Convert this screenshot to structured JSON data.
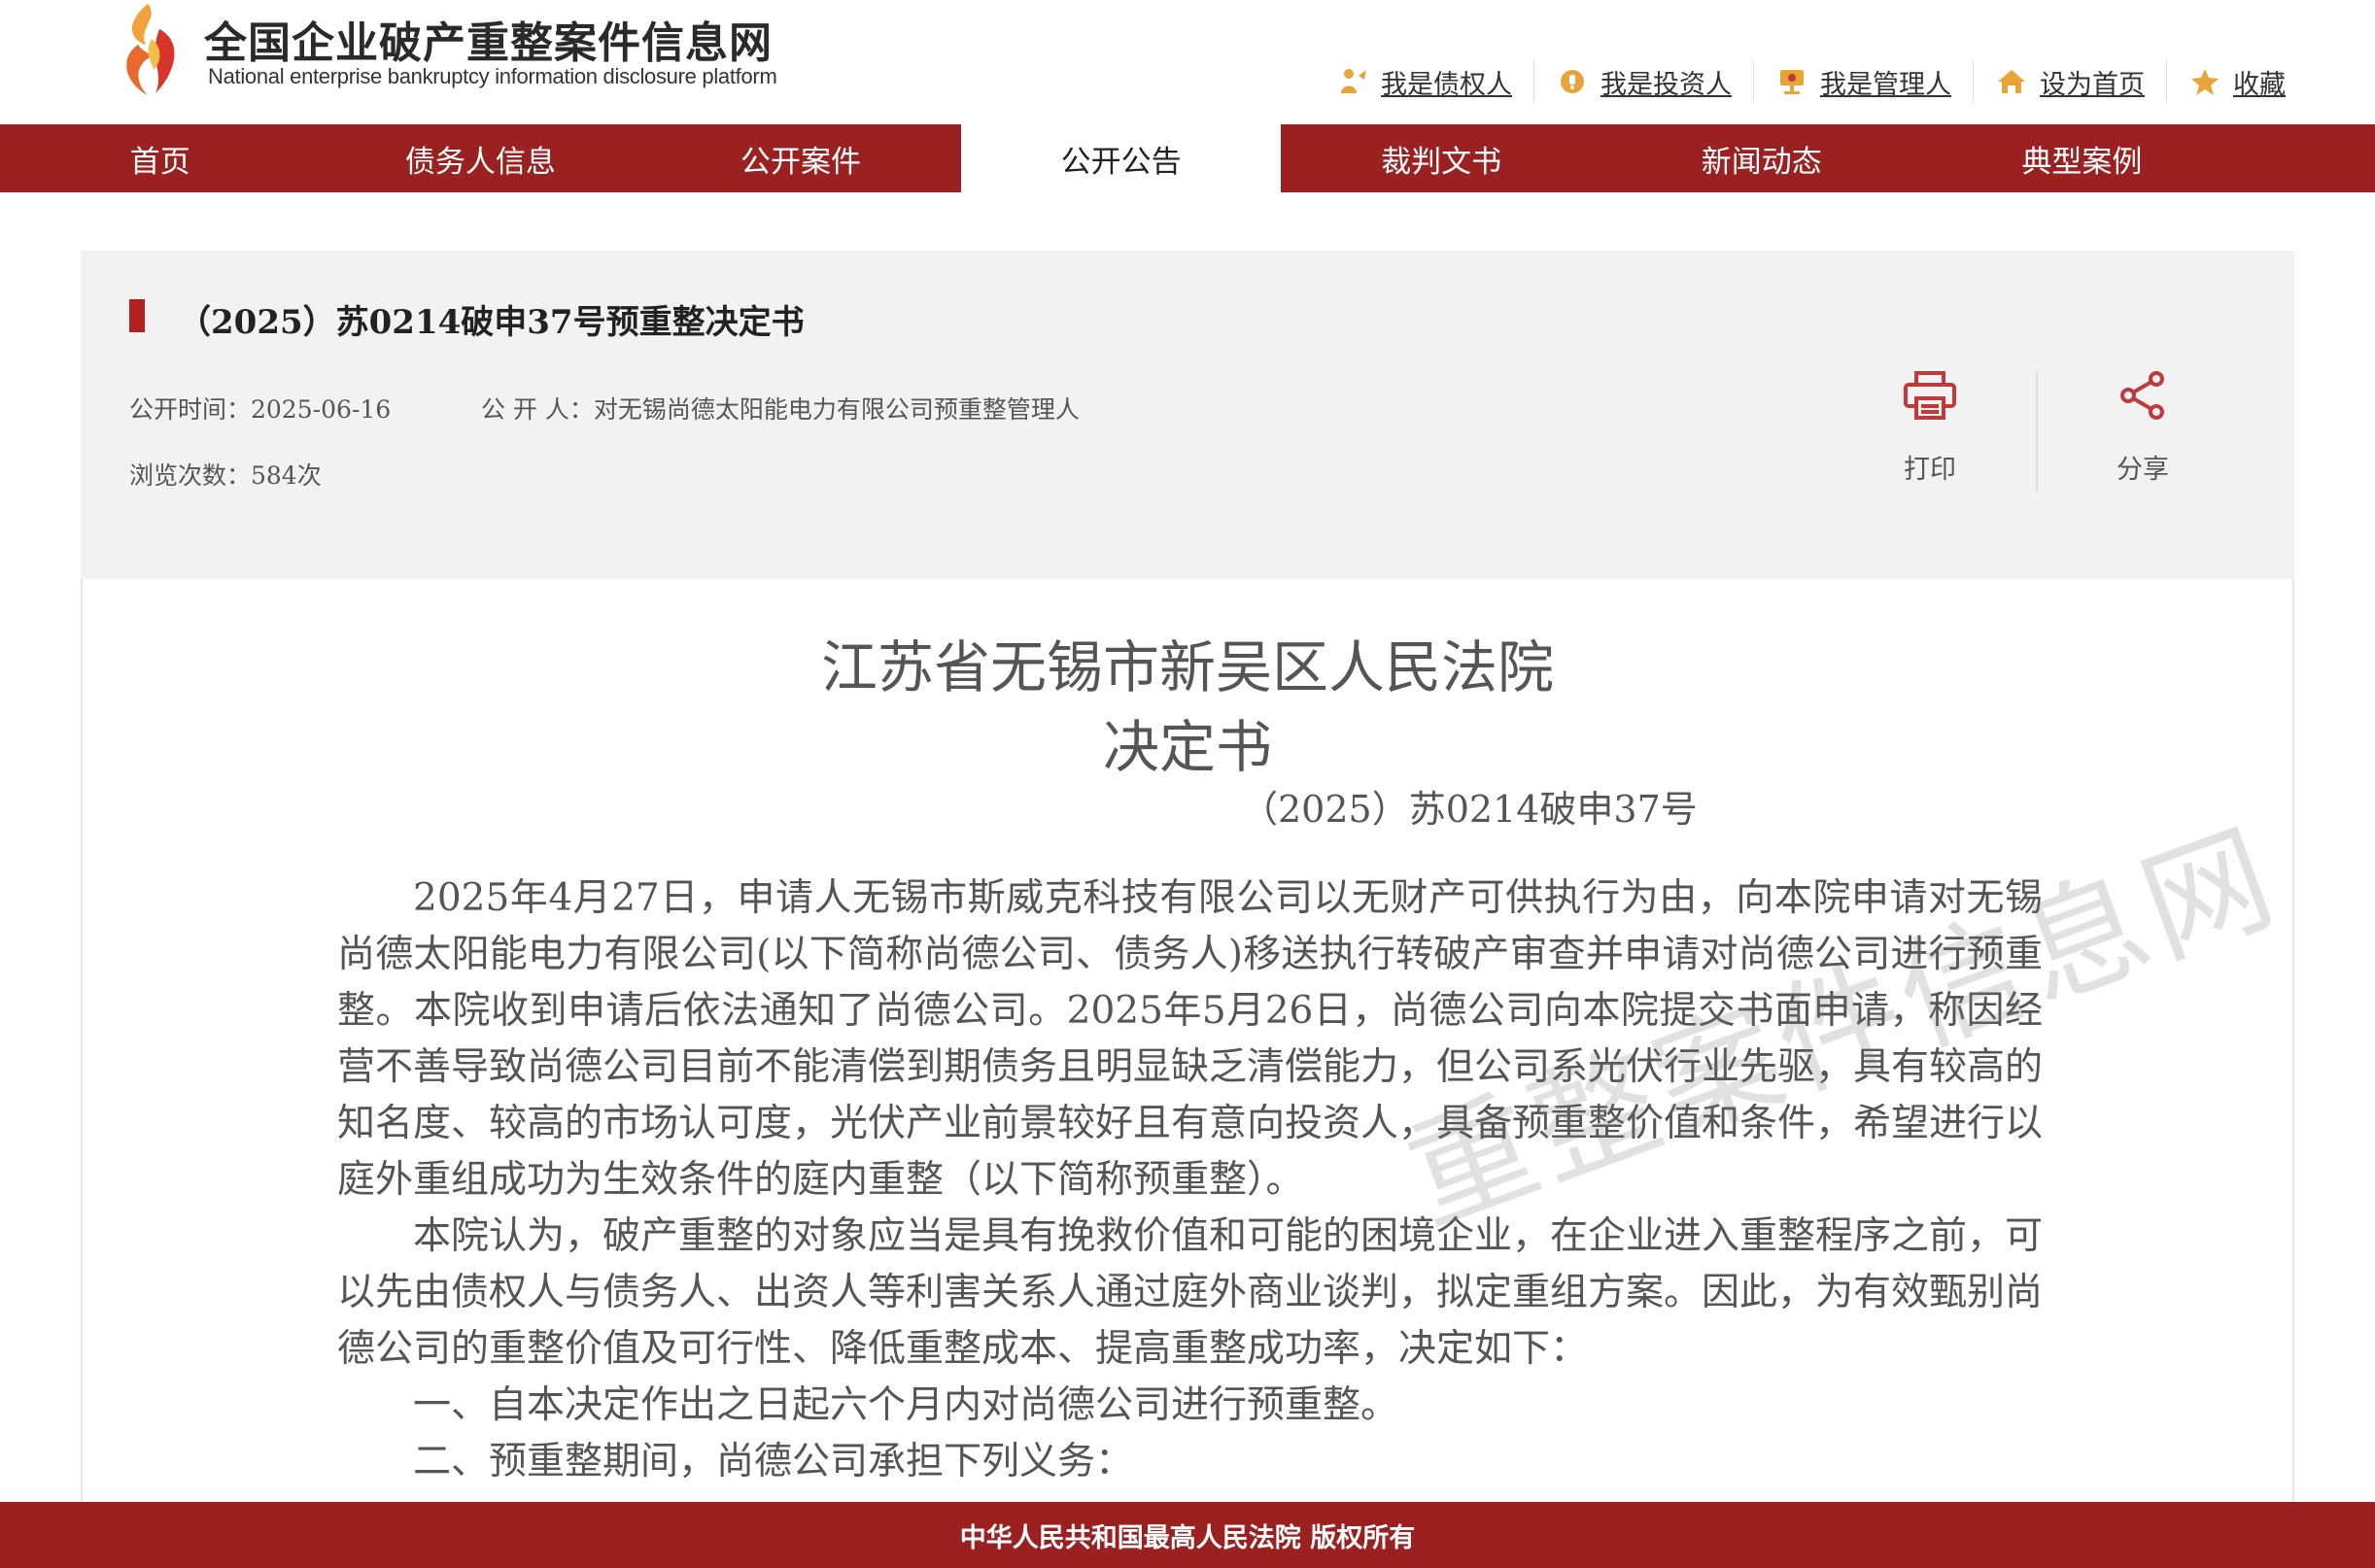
{
  "site": {
    "name_cn": "全国企业破产重整案件信息网",
    "name_en": "National enterprise bankruptcy  information disclosure platform"
  },
  "toplinks": [
    {
      "label": "我是债权人",
      "icon": "creditor-icon"
    },
    {
      "label": "我是投资人",
      "icon": "investor-icon"
    },
    {
      "label": "我是管理人",
      "icon": "administrator-icon"
    },
    {
      "label": "设为首页",
      "icon": "home-icon"
    },
    {
      "label": "收藏",
      "icon": "star-icon"
    }
  ],
  "nav": {
    "items": [
      "首页",
      "债务人信息",
      "公开案件",
      "公开公告",
      "裁判文书",
      "新闻动态",
      "典型案例"
    ],
    "active_index": 3
  },
  "article": {
    "title": "（2025）苏0214破申37号预重整决定书",
    "publish_time": "公开时间：2025-06-16",
    "publisher": "公 开 人：对无锡尚德太阳能电力有限公司预重整管理人",
    "views": "浏览次数：584次",
    "print_label": "打印",
    "share_label": "分享"
  },
  "document": {
    "court": "江苏省无锡市新吴区人民法院",
    "doc_type": "决定书",
    "doc_number": "（2025）苏0214破申37号",
    "paragraphs": [
      "2025年4月27日，申请人无锡市斯威克科技有限公司以无财产可供执行为由，向本院申请对无锡尚德太阳能电力有限公司(以下简称尚德公司、债务人)移送执行转破产审查并申请对尚德公司进行预重整。本院收到申请后依法通知了尚德公司。2025年5月26日，尚德公司向本院提交书面申请，称因经营不善导致尚德公司目前不能清偿到期债务且明显缺乏清偿能力，但公司系光伏行业先驱，具有较高的知名度、较高的市场认可度，光伏产业前景较好且有意向投资人，具备预重整价值和条件，希望进行以庭外重组成功为生效条件的庭内重整（以下简称预重整）。",
      "本院认为，破产重整的对象应当是具有挽救价值和可能的困境企业，在企业进入重整程序之前，可以先由债权人与债务人、出资人等利害关系人通过庭外商业谈判，拟定重组方案。因此，为有效甄别尚德公司的重整价值及可行性、降低重整成本、提高重整成功率，决定如下：",
      "一、自本决定作出之日起六个月内对尚德公司进行预重整。",
      "二、预重整期间，尚德公司承担下列义务："
    ],
    "watermark": "重整案件信息网"
  },
  "footer": {
    "text": "中华人民共和国最高人民法院 版权所有"
  },
  "colors": {
    "brand_red": "#9b2120",
    "accent_red": "#b3201f",
    "icon_gold": "#e8a33a",
    "icon_red": "#c0393b"
  }
}
